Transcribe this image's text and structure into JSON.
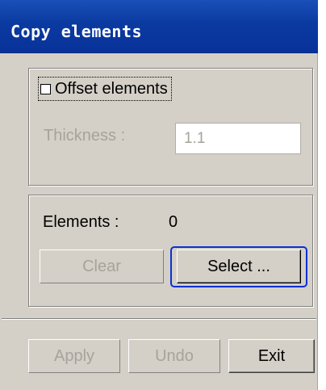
{
  "dialog": {
    "title": "Copy elements"
  },
  "offset_group": {
    "checkbox_label": "Offset elements",
    "checkbox_checked": false,
    "thickness_label": "Thickness :",
    "thickness_value": "1.1"
  },
  "elements_group": {
    "elements_label": "Elements :",
    "elements_count": "0",
    "clear_label": "Clear",
    "select_label": "Select ..."
  },
  "footer": {
    "apply_label": "Apply",
    "undo_label": "Undo",
    "exit_label": "Exit"
  },
  "colors": {
    "titlebar": "#0a3aa0",
    "dialog_background": "#d4d0c8",
    "focus_ring": "#0a2fd4",
    "disabled_text": "#a6a39c"
  }
}
